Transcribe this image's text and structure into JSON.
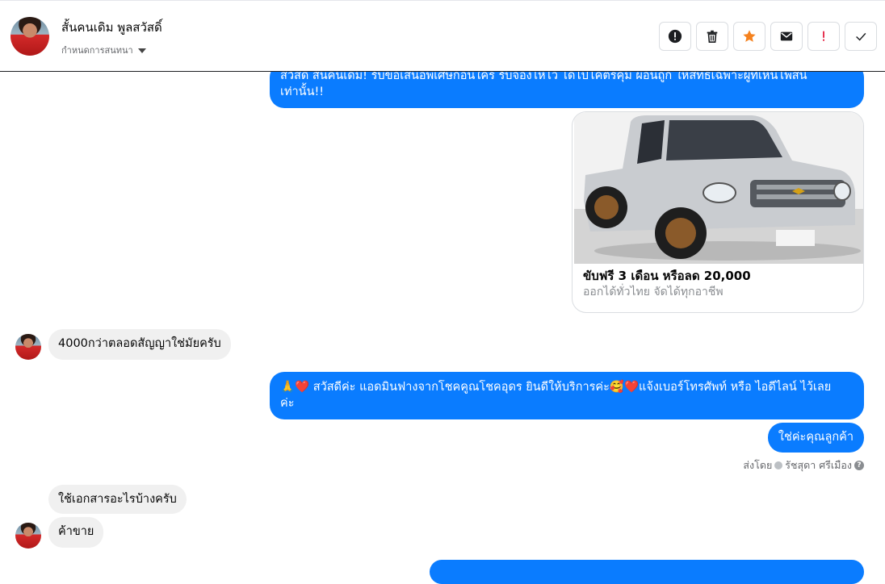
{
  "header": {
    "name": "สั้นคนเดิม พูลสวัสดิ์",
    "subtitle": "กำหนดการสนทนา",
    "actions": [
      {
        "name": "report-icon",
        "glyph": "!"
      },
      {
        "name": "trash-icon"
      },
      {
        "name": "star-icon"
      },
      {
        "name": "mail-icon"
      },
      {
        "name": "important-icon",
        "glyph": "!"
      },
      {
        "name": "check-icon"
      }
    ]
  },
  "messages": {
    "m1": {
      "line1": "สวัสดี สั้นคนเดิม! รับข้อเสนอพิเศษก่อนใคร รับจองไห้ไว ได้ไปโคตรคุ้ม ผ่อนถูก ให้สิทธิเฉพาะผู้ที่เห็นโพสนี้",
      "line2": "เท่านั้น!!"
    },
    "card": {
      "title": "ขับฟรี 3 เดือน หรือลด 20,000",
      "subtitle": "ออกได้ทั่วไทย จัดได้ทุกอาชีพ"
    },
    "m2": "4000กว่าตลอดสัญญาใช่มัยครับ",
    "m3": {
      "line1": "🙏❤️ สวัสดีค่ะ แอดมินฟางจากโชคคูณโชคอุดร ยินดีให้บริการค่ะ🥰❤️แจ้งเบอร์โทรศัพท์ หรือ ไอดีไลน์  ไว้เลย",
      "line2": "ค่ะ"
    },
    "m4": "ใช่ค่ะคุณลูกค้า",
    "sent_by": {
      "prefix": "ส่งโดย",
      "agent": "รัชสุดา ศรีเมือง",
      "help": "?"
    },
    "m5": "ใช้เอกสารอะไรบ้างครับ",
    "m6": "ค้าขาย"
  },
  "colors": {
    "outgoing": "#0a7cff",
    "incoming": "#f0f0f0",
    "star": "#f5821f",
    "important": "#e41e3f"
  }
}
